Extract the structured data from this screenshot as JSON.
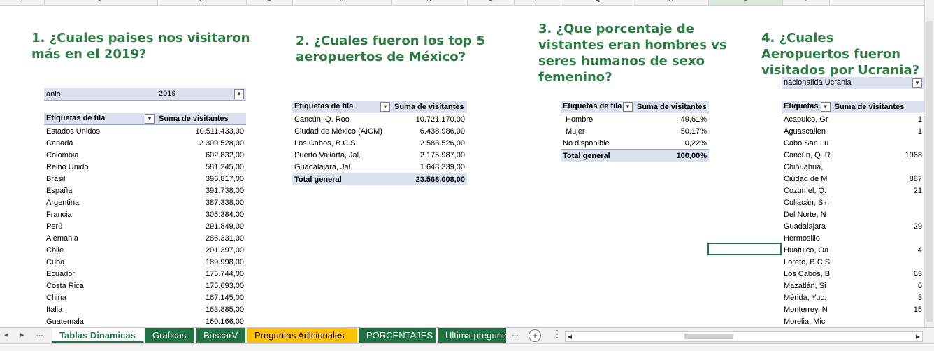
{
  "columns": [
    "I",
    "J",
    "K",
    "L",
    "M",
    "N",
    "O",
    "P",
    "Q",
    "R",
    "S",
    "T"
  ],
  "questions": [
    {
      "title": "1. ¿Cuales paises nos visitaron\nmás en el 2019?"
    },
    {
      "title": "2. ¿Cuales fueron los top 5\naeropuertos de México?"
    },
    {
      "title": "3. ¿Que porcentaje de\nvistantes eran hombres vs\nseres humanos de sexo\nfemenino?"
    },
    {
      "title": "4. ¿Cuales Aeropuertos fueron\nvisitados por Ucrania?"
    }
  ],
  "pivot1": {
    "filter_label": "anio",
    "filter_value": "2019",
    "col1": "Etiquetas de fila",
    "col2": "Suma de visitantes",
    "rows": [
      {
        "label": "Estados Unidos",
        "value": "10.511.433,00"
      },
      {
        "label": "Canadá",
        "value": "2.309.528,00"
      },
      {
        "label": "Colombia",
        "value": "602.832,00"
      },
      {
        "label": "Reino Unido",
        "value": "581.245,00"
      },
      {
        "label": "Brasil",
        "value": "396.817,00"
      },
      {
        "label": "España",
        "value": "391.738,00"
      },
      {
        "label": "Argentina",
        "value": "387.338,00"
      },
      {
        "label": "Francia",
        "value": "305.384,00"
      },
      {
        "label": "Perú",
        "value": "291.849,00"
      },
      {
        "label": "Alemania",
        "value": "286.331,00"
      },
      {
        "label": "Chile",
        "value": "201.397,00"
      },
      {
        "label": "Cuba",
        "value": "189.998,00"
      },
      {
        "label": "Ecuador",
        "value": "175.744,00"
      },
      {
        "label": "Costa Rica",
        "value": "175.693,00"
      },
      {
        "label": "China",
        "value": "167.145,00"
      },
      {
        "label": "Italia",
        "value": "163.885,00"
      },
      {
        "label": "Guatemala",
        "value": "160.166,00"
      }
    ]
  },
  "pivot2": {
    "col1": "Etiquetas de fila",
    "col2": "Suma de visitantes",
    "rows": [
      {
        "label": "Cancún, Q. Roo",
        "value": "10.721.170,00"
      },
      {
        "label": "Ciudad de México (AICM)",
        "value": "6.438.986,00"
      },
      {
        "label": "Los Cabos, B.C.S.",
        "value": "2.583.526,00"
      },
      {
        "label": "Puerto Vallarta, Jal.",
        "value": "2.175.987,00"
      },
      {
        "label": "Guadalajara, Jal.",
        "value": "1.648.339,00"
      }
    ],
    "total_label": "Total general",
    "total_value": "23.568.008,00"
  },
  "pivot3": {
    "col1": "Etiquetas de fila",
    "col2": "Suma de visitantes",
    "rows": [
      {
        "label": "Hombre",
        "value": "49,61%"
      },
      {
        "label": "Mujer",
        "value": "50,17%"
      },
      {
        "label": "No disponible",
        "value": "0,22%"
      }
    ],
    "total_label": "Total general",
    "total_value": "100,00%"
  },
  "pivot4": {
    "filter_label": "nacionalida",
    "filter_value": "Ucrania",
    "col1": "Etiquetas",
    "col2": "Suma de visitantes",
    "rows": [
      {
        "label": "Acapulco, Gr",
        "value": "1"
      },
      {
        "label": "Aguascalien",
        "value": "1"
      },
      {
        "label": "Cabo San Lu",
        "value": ""
      },
      {
        "label": "Cancún, Q. R",
        "value": "1968"
      },
      {
        "label": "Chihuahua,",
        "value": ""
      },
      {
        "label": "Ciudad de M",
        "value": "887"
      },
      {
        "label": "Cozumel, Q.",
        "value": "21"
      },
      {
        "label": "Culiacán, Sin",
        "value": ""
      },
      {
        "label": "Del Norte, N",
        "value": ""
      },
      {
        "label": "Guadalajara",
        "value": "29"
      },
      {
        "label": "Hermosillo,",
        "value": ""
      },
      {
        "label": "Huatulco, Oa",
        "value": "4"
      },
      {
        "label": "Loreto, B.C.S",
        "value": ""
      },
      {
        "label": "Los Cabos, B",
        "value": "63"
      },
      {
        "label": "Mazatlán, Si",
        "value": "6"
      },
      {
        "label": "Mérida, Yuc.",
        "value": "3"
      },
      {
        "label": "Monterrey, N",
        "value": "15"
      },
      {
        "label": "Morelia, Mic",
        "value": ""
      }
    ]
  },
  "tabs": [
    {
      "label": "Tablas Dinamicas",
      "state": "active"
    },
    {
      "label": "Graficas",
      "state": "normal"
    },
    {
      "label": "BuscarV",
      "state": "normal"
    },
    {
      "label": "Preguntas Adicionales",
      "state": "yellow"
    },
    {
      "label": "PORCENTAJES",
      "state": "normal"
    },
    {
      "label": "Ultima pregunta",
      "state": "normal"
    }
  ],
  "nav": {
    "prev": "◂",
    "next": "▸",
    "more": "...",
    "more_right": "...",
    "add": "+"
  },
  "colors": {
    "title_green": "#2e7a43",
    "excel_green": "#217346",
    "pivot_header": "#dce1f0",
    "tab_yellow": "#ffc000"
  }
}
